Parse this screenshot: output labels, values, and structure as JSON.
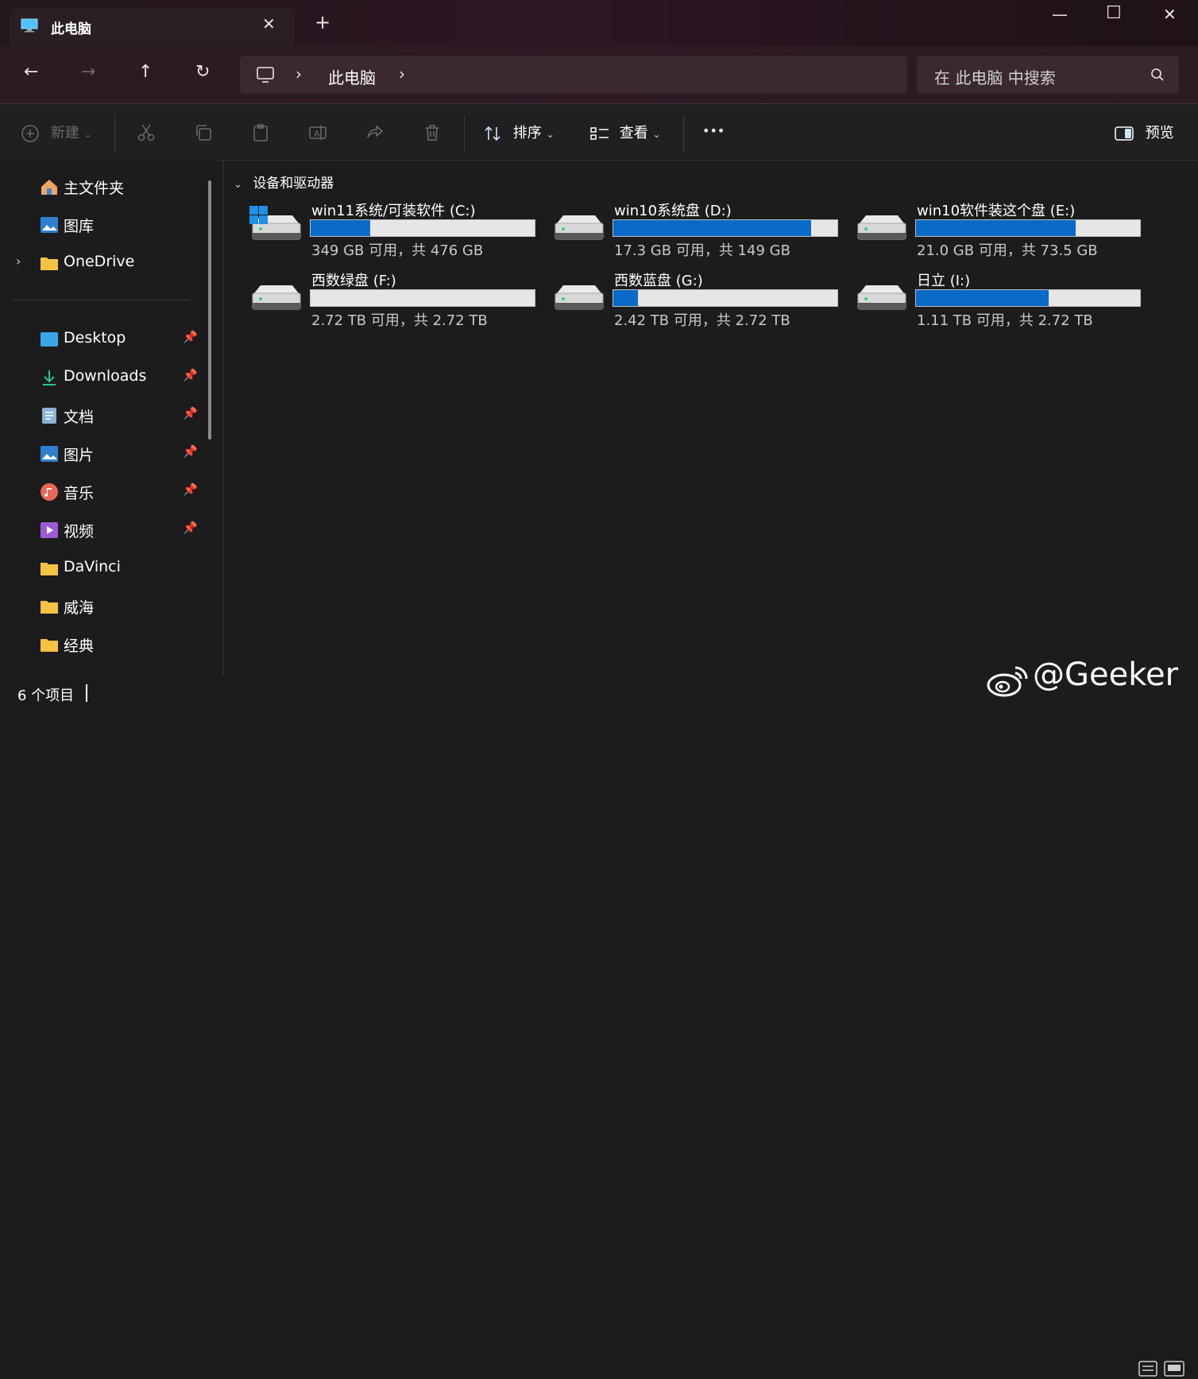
{
  "window": {
    "tab_title": "此电脑",
    "tab_close": "✕",
    "new_tab": "+",
    "minimize": "—",
    "maximize": "☐",
    "close": "✕"
  },
  "nav": {
    "back": "←",
    "forward": "→",
    "up": "↑",
    "refresh": "↻",
    "breadcrumb_sep": "›",
    "breadcrumb": "此电脑",
    "search_placeholder": "在 此电脑 中搜索"
  },
  "toolbar": {
    "new_label": "新建",
    "sort_label": "排序",
    "view_label": "查看",
    "more_label": "•••",
    "preview_label": "预览"
  },
  "sidebar": {
    "items": [
      {
        "label": "主文件夹",
        "icon": "home-icon",
        "pinned": false
      },
      {
        "label": "图库",
        "icon": "gallery-icon",
        "pinned": false
      },
      {
        "label": "OneDrive",
        "icon": "folder-icon",
        "pinned": false
      },
      {
        "label": "Desktop",
        "icon": "desktop-icon",
        "pinned": true
      },
      {
        "label": "Downloads",
        "icon": "download-icon",
        "pinned": true
      },
      {
        "label": "文档",
        "icon": "document-icon",
        "pinned": true
      },
      {
        "label": "图片",
        "icon": "pictures-icon",
        "pinned": true
      },
      {
        "label": "音乐",
        "icon": "music-icon",
        "pinned": true
      },
      {
        "label": "视频",
        "icon": "video-icon",
        "pinned": true
      },
      {
        "label": "DaVinci",
        "icon": "folder-icon",
        "pinned": false
      },
      {
        "label": "威海",
        "icon": "folder-icon",
        "pinned": false
      },
      {
        "label": "经典",
        "icon": "folder-icon",
        "pinned": false
      }
    ]
  },
  "main": {
    "group_header": "设备和驱动器",
    "drives": [
      {
        "name": "win11系统/可装软件 (C:)",
        "info": "349 GB 可用，共 476 GB",
        "used_fraction": 0.267,
        "system": true
      },
      {
        "name": "win10系统盘 (D:)",
        "info": "17.3 GB 可用，共 149 GB",
        "used_fraction": 0.884,
        "system": false
      },
      {
        "name": "win10软件装这个盘 (E:)",
        "info": "21.0 GB 可用，共 73.5 GB",
        "used_fraction": 0.714,
        "system": false
      },
      {
        "name": "西数绿盘 (F:)",
        "info": "2.72 TB 可用，共 2.72 TB",
        "used_fraction": 0.0,
        "system": false
      },
      {
        "name": "西数蓝盘 (G:)",
        "info": "2.42 TB 可用，共 2.72 TB",
        "used_fraction": 0.11,
        "system": false
      },
      {
        "name": "日立 (I:)",
        "info": "1.11 TB 可用，共 2.72 TB",
        "used_fraction": 0.592,
        "system": false
      }
    ]
  },
  "status": {
    "item_count": "6 个项目"
  },
  "watermark": "@Geeker",
  "colors": {
    "accent": "#0a6ac7",
    "background": "#1c1c1c"
  }
}
